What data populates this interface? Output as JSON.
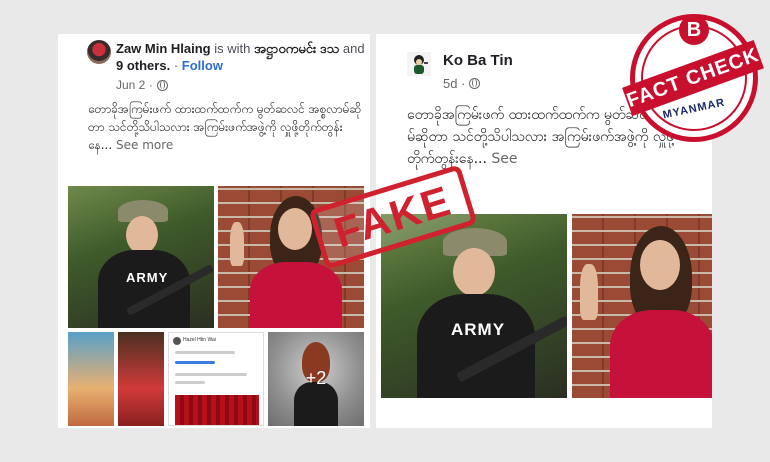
{
  "left_post": {
    "author": "Zaw Min Hlaing",
    "with_text": "is with",
    "tagged_name": "အဋ္ဌာဝကမင်း ဒသ",
    "and_text": "and",
    "others": "9 others.",
    "follow_label": "Follow",
    "date": "Jun 2 ·",
    "body": "တောခိုအကြမ်းဖက် ထားထက်ထက်က မွတ်ဆလင် အစ္စလာမ်ဆိုတာ သင်တို့သိပါသလား အကြမ်းဖက်အဖွဲ့ကို လှူဖို့တိုက်တွန်းနေ...",
    "see_more": "See more",
    "photo_badge": "ARMY",
    "more_count": "+2",
    "mini_post_name": "Hazel Htin Wai"
  },
  "right_post": {
    "author": "Ko Ba Tin",
    "date": "5d ·",
    "body": "တောခိုအကြမ်းဖက် ထားထက်ထက်က မွတ်ဆလင် အစ္စလာမ်ဆိုတာ သင်တို့သိပါသလား အကြမ်းဖက်အဖွဲ့ကို လှူဖို့တိုက်တွန်းနေ...",
    "see_more": "See",
    "photo_badge": "ARMY"
  },
  "fake_stamp": "FAKE",
  "badge": {
    "letter": "B",
    "ribbon": "FACT CHECK",
    "country": "MYANMAR"
  },
  "colors": {
    "stamp_red": "#d0212f",
    "link_blue": "#2d6fd2",
    "badge_red": "#c8102e"
  }
}
